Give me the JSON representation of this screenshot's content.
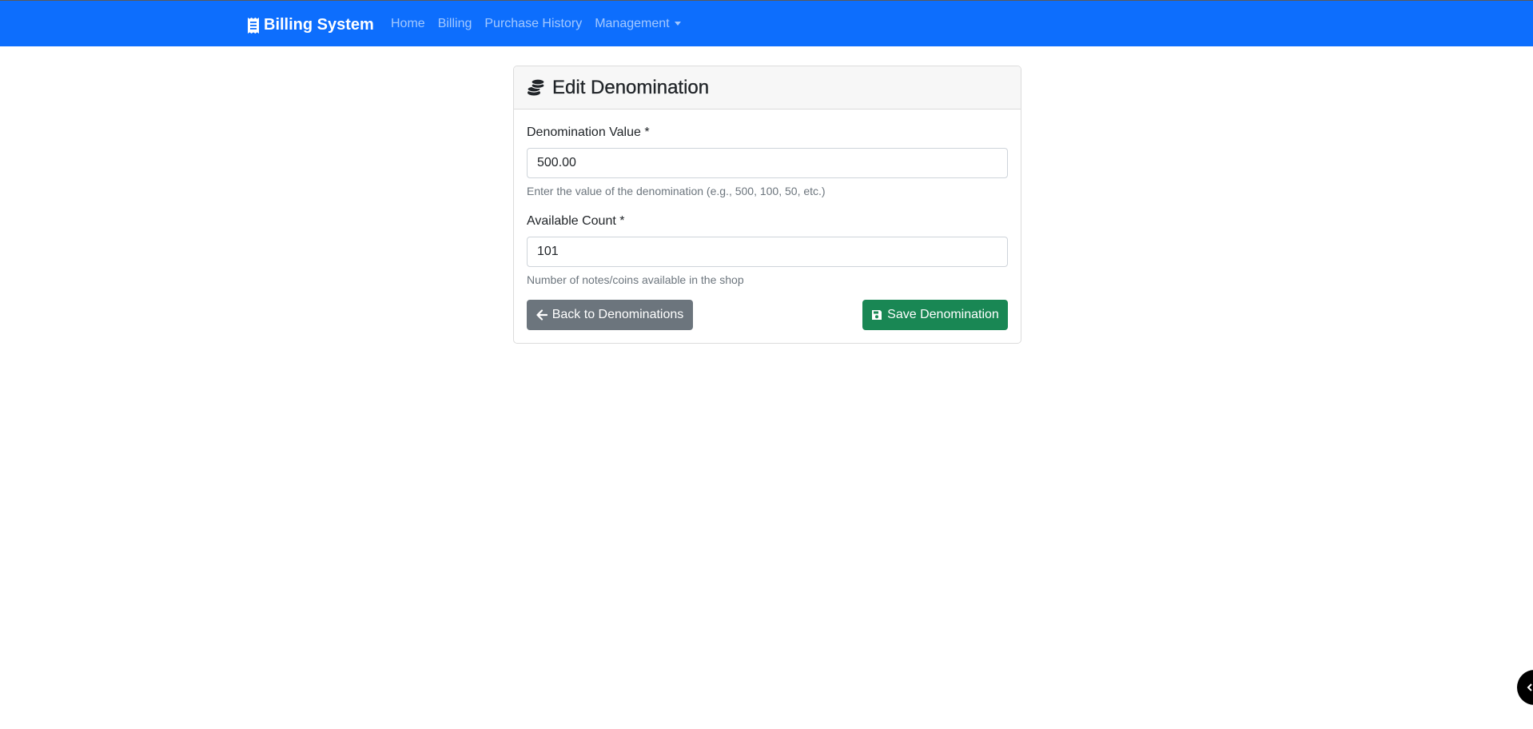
{
  "brand": {
    "title": "Billing System",
    "icon": "receipt-icon"
  },
  "nav": {
    "items": [
      {
        "label": "Home"
      },
      {
        "label": "Billing"
      },
      {
        "label": "Purchase History"
      },
      {
        "label": "Management"
      }
    ]
  },
  "card": {
    "title": "Edit Denomination",
    "icon": "coins-icon"
  },
  "form": {
    "denomination_label": "Denomination Value *",
    "denomination_value": "500.00",
    "denomination_help": "Enter the value of the denomination (e.g., 500, 100, 50, etc.)",
    "count_label": "Available Count *",
    "count_value": "101",
    "count_help": "Number of notes/coins available in the shop"
  },
  "actions": {
    "back_label": "Back to Denominations",
    "save_label": "Save Denomination"
  },
  "colors": {
    "navbar": "#0d6efd",
    "back_button": "#6c757d",
    "save_button": "#198754"
  }
}
